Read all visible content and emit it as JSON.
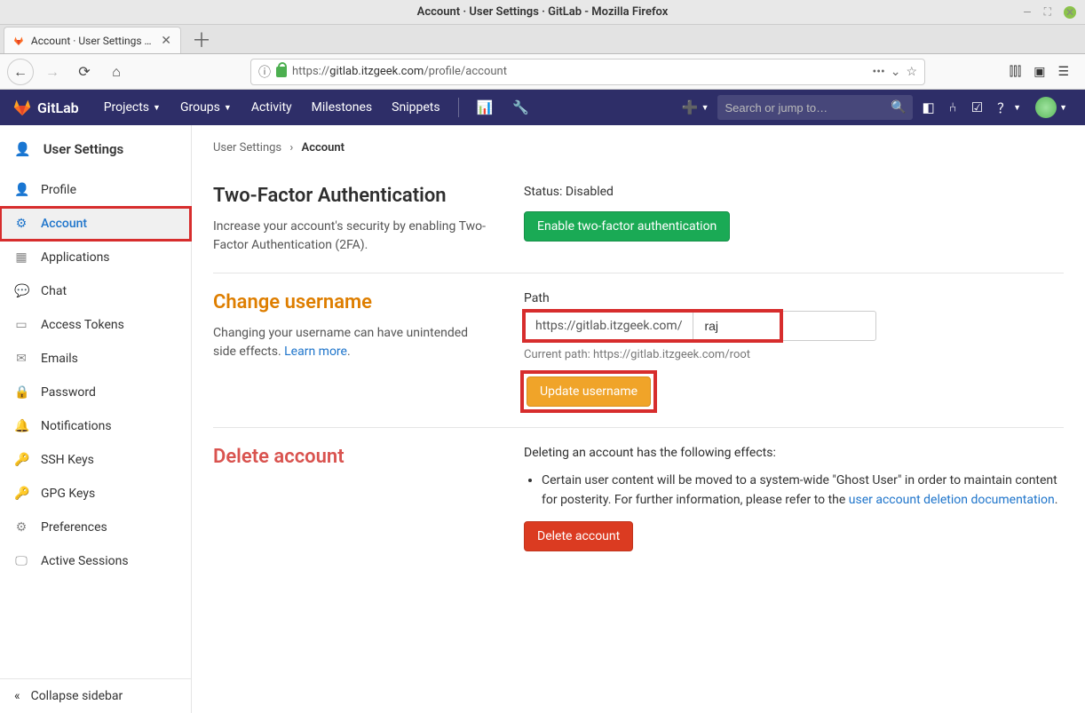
{
  "os": {
    "title": "Account · User Settings · GitLab - Mozilla Firefox"
  },
  "browser": {
    "tab_title": "Account · User Settings · GitL…",
    "url_prefix": "https://",
    "url_host": "gitlab.itzgeek.com",
    "url_path": "/profile/account"
  },
  "gitlab_nav": {
    "brand": "GitLab",
    "projects": "Projects",
    "groups": "Groups",
    "activity": "Activity",
    "milestones": "Milestones",
    "snippets": "Snippets",
    "search_placeholder": "Search or jump to…"
  },
  "sidebar": {
    "header": "User Settings",
    "items": [
      {
        "label": "Profile",
        "icon": "👤"
      },
      {
        "label": "Account",
        "icon": "⚙"
      },
      {
        "label": "Applications",
        "icon": "▦"
      },
      {
        "label": "Chat",
        "icon": "💬"
      },
      {
        "label": "Access Tokens",
        "icon": "▭"
      },
      {
        "label": "Emails",
        "icon": "✉"
      },
      {
        "label": "Password",
        "icon": "🔒"
      },
      {
        "label": "Notifications",
        "icon": "🔔"
      },
      {
        "label": "SSH Keys",
        "icon": "🔑"
      },
      {
        "label": "GPG Keys",
        "icon": "🔑"
      },
      {
        "label": "Preferences",
        "icon": "⚙"
      },
      {
        "label": "Active Sessions",
        "icon": "🖵"
      }
    ],
    "collapse": "Collapse sidebar"
  },
  "breadcrumb": {
    "root": "User Settings",
    "current": "Account"
  },
  "twofa": {
    "title": "Two-Factor Authentication",
    "desc": "Increase your account's security by enabling Two-Factor Authentication (2FA).",
    "status": "Status: Disabled",
    "enable_btn": "Enable two-factor authentication"
  },
  "username": {
    "title": "Change username",
    "desc": "Changing your username can have unintended side effects. ",
    "learn_more": "Learn more",
    "path_label": "Path",
    "path_prefix": "https://gitlab.itzgeek.com/",
    "path_value": "raj",
    "current_path": "Current path: https://gitlab.itzgeek.com/root",
    "update_btn": "Update username"
  },
  "delete": {
    "title": "Delete account",
    "intro": "Deleting an account has the following effects:",
    "bullet": "Certain user content will be moved to a system-wide \"Ghost User\" in order to maintain content for posterity. For further information, please refer to the ",
    "doc_link": "user account deletion documentation",
    "btn": "Delete account"
  }
}
